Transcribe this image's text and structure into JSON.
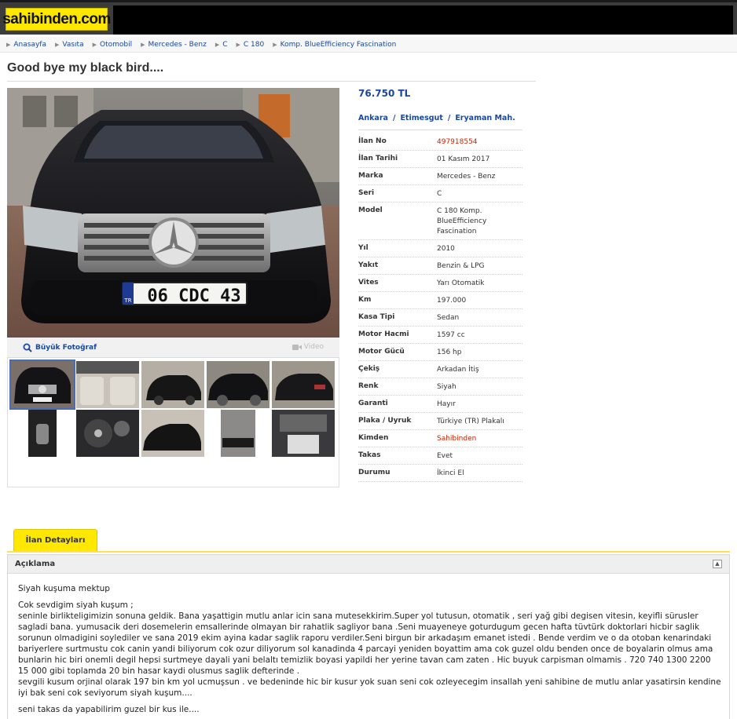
{
  "header": {
    "logo_text": "sahibinden.com"
  },
  "breadcrumb": [
    "Anasayfa",
    "Vasıta",
    "Otomobil",
    "Mercedes - Benz",
    "C",
    "C 180",
    "Komp. BlueEfficiency Fascination"
  ],
  "listing": {
    "title": "Good bye my black bird....",
    "price": "76.750 TL",
    "location": [
      "Ankara",
      "Etimesgut",
      "Eryaman Mah."
    ],
    "plate_text": "06 CDC 43",
    "plate_country": "TR"
  },
  "photo": {
    "big_photo_label": "Büyük Fotoğraf",
    "video_label": "Video",
    "thumbnail_count": 10,
    "selected_thumbnail": 1
  },
  "info": [
    {
      "label": "İlan No",
      "value": "497918554",
      "highlight": true
    },
    {
      "label": "İlan Tarihi",
      "value": "01 Kasım 2017"
    },
    {
      "label": "Marka",
      "value": "Mercedes - Benz"
    },
    {
      "label": "Seri",
      "value": "C"
    },
    {
      "label": "Model",
      "value": "C 180 Komp. BlueEfficiency Fascination"
    },
    {
      "label": "Yıl",
      "value": "2010"
    },
    {
      "label": "Yakıt",
      "value": "Benzin & LPG"
    },
    {
      "label": "Vites",
      "value": "Yarı Otomatik"
    },
    {
      "label": "Km",
      "value": "197.000"
    },
    {
      "label": "Kasa Tipi",
      "value": "Sedan"
    },
    {
      "label": "Motor Hacmi",
      "value": "1597 cc"
    },
    {
      "label": "Motor Gücü",
      "value": "156 hp"
    },
    {
      "label": "Çekiş",
      "value": "Arkadan İtiş"
    },
    {
      "label": "Renk",
      "value": "Siyah"
    },
    {
      "label": "Garanti",
      "value": "Hayır"
    },
    {
      "label": "Plaka / Uyruk",
      "value": "Türkiye (TR) Plakalı"
    },
    {
      "label": "Kimden",
      "value": "Sahibinden",
      "highlight": true
    },
    {
      "label": "Takas",
      "value": "Evet"
    },
    {
      "label": "Durumu",
      "value": "İkinci El"
    }
  ],
  "tabs": {
    "details_label": "İlan Detayları"
  },
  "description": {
    "heading": "Açıklama",
    "paragraphs": [
      "Siyah kuşuma mektup",
      "Cok sevdigim siyah kuşum ;\nseninle birlikteligimizin sonuna geldik. Bana yaşattigin mutlu anlar icin sana mutesekkirim.Super yol tutusun, otomatik ,  seri yağ gibi degisen vitesin, keyifli sürusler sagladi bana. yumusacik deri dosemelerin emsallerinde olmayan bir rahatlik sagliyor bana .Seni muayeneye goturdugum gecen hafta tüvtürk doktorlari hicbir saglik sorunun olmadigini soylediler ve sana 2019 ekim ayina kadar saglik raporu verdiler.Seni birgun bir arkadaşım emanet istedi . Bende verdim ve o da otoban kenarindaki bariyerlere surtmustu cok canin yandi biliyorum cok ozur diliyorum  sol kanadinda 4 parcayi yeniden boyattim ama cok guzel oldu benden once de boyalarin olmus ama bunlarin hic biri onemli degil hepsi surtmeye dayali yani belaltı temizlik boyasi yapildi her yerine tavan cam zaten . Hic buyuk carpisman olmamis . 720 740 1300 2200 15 000 gibi toplamda 20 bin hasar kaydi olusmus saglik defterinde .\nsevgili kusum orjinal olarak 197 bin km yol ucmuşsun . ve bedeninde   hic bir kusur yok suan seni cok ozleyecegim insallah yeni sahibine de mutlu anlar yasatirsin kendine iyi bak seni cok seviyorum siyah kuşum....",
      "seni takas da yapabilirim guzel bir kus ile...."
    ]
  },
  "colors": {
    "accent_yellow": "#ffe800",
    "link_blue": "#1a47a0",
    "highlight_red": "#cc2200"
  }
}
